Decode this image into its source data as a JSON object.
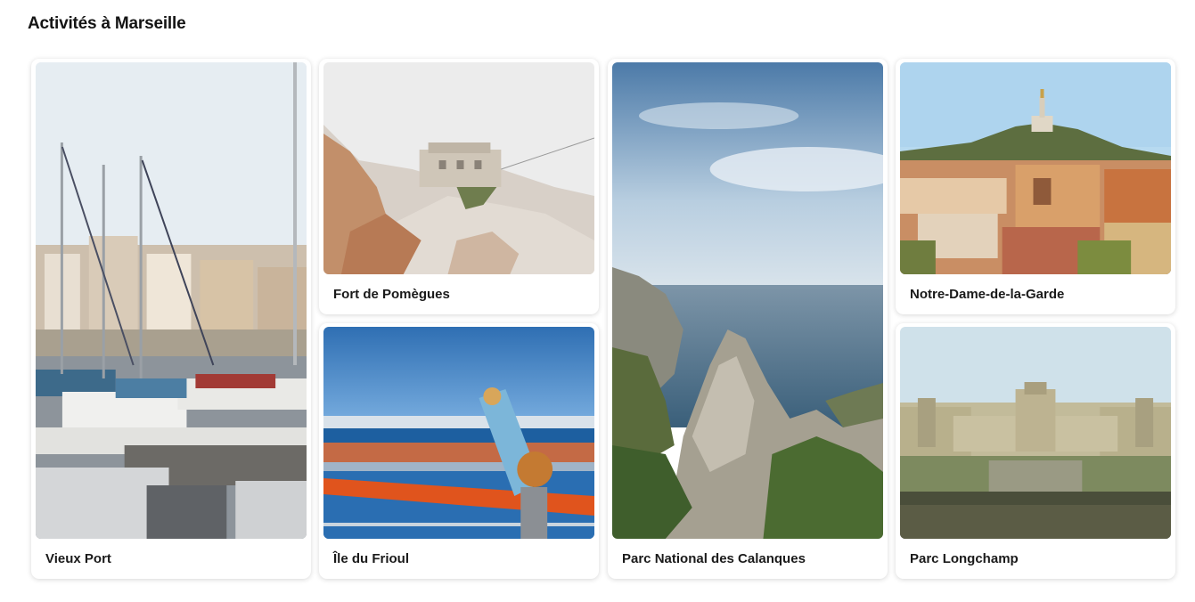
{
  "section": {
    "title": "Activités à Marseille"
  },
  "activities": [
    {
      "label": "Vieux Port",
      "image": "marina-sailboats-photo"
    },
    {
      "label": "Fort de Pomègues",
      "image": "fort-on-rocks-photo"
    },
    {
      "label": "Île du Frioul",
      "image": "island-telescope-photo"
    },
    {
      "label": "Parc National des Calanques",
      "image": "calanques-cliffs-photo"
    },
    {
      "label": "Notre-Dame-de-la-Garde",
      "image": "basilica-hill-photo"
    },
    {
      "label": "Parc Longchamp",
      "image": "palais-longchamp-photo"
    }
  ]
}
